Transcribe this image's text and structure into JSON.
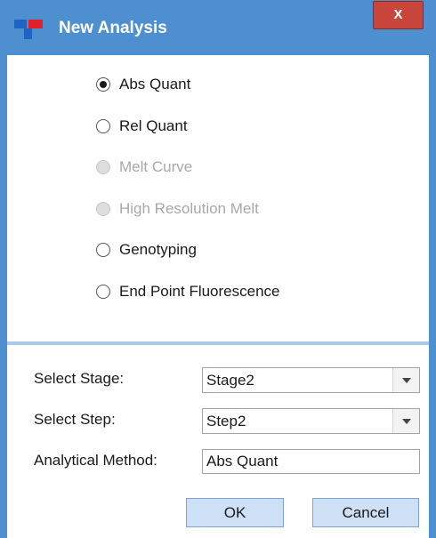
{
  "window": {
    "title": "New Analysis",
    "close_label": "X"
  },
  "analysis_types": [
    {
      "label": "Abs Quant",
      "checked": true,
      "disabled": false
    },
    {
      "label": "Rel Quant",
      "checked": false,
      "disabled": false
    },
    {
      "label": "Melt Curve",
      "checked": false,
      "disabled": true
    },
    {
      "label": "High Resolution Melt",
      "checked": false,
      "disabled": true
    },
    {
      "label": "Genotyping",
      "checked": false,
      "disabled": false
    },
    {
      "label": "End Point Fluorescence",
      "checked": false,
      "disabled": false
    }
  ],
  "form": {
    "stage_label": "Select Stage:",
    "stage_value": "Stage2",
    "step_label": "Select Step:",
    "step_value": "Step2",
    "method_label": "Analytical Method:",
    "method_value": "Abs Quant"
  },
  "buttons": {
    "ok_label": "OK",
    "cancel_label": "Cancel"
  },
  "colors": {
    "title_bar": "#4e8fd0",
    "close_button": "#c9463d",
    "button_fill": "#cde0f5",
    "logo_blue": "#1f63c4",
    "logo_red": "#e0202a"
  },
  "icons": {
    "app_logo": "app-logo-icon",
    "close": "close-icon",
    "dropdown": "chevron-down-icon"
  }
}
